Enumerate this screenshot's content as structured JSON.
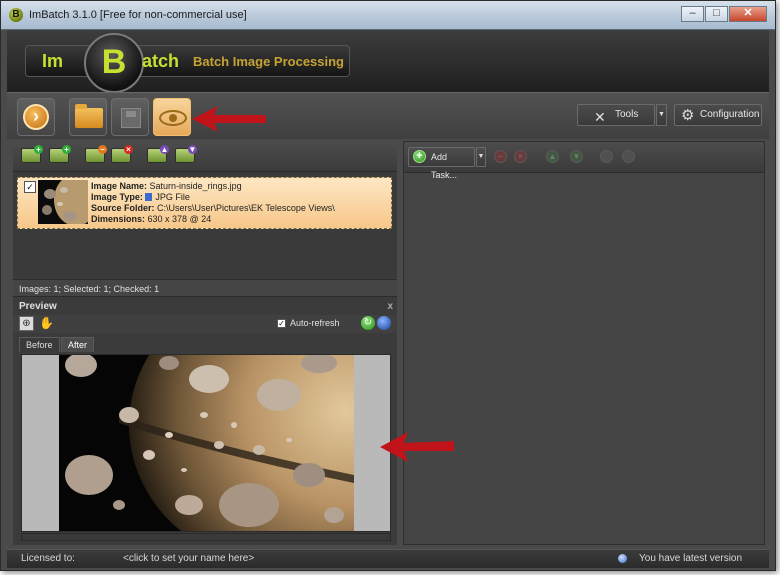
{
  "window": {
    "title": "ImBatch 3.1.0 [Free for non-commercial use]",
    "app_icon_letter": "B",
    "minimize_glyph": "–",
    "maximize_glyph": "□",
    "close_glyph": "✕"
  },
  "logo": {
    "prefix": "Im",
    "letter": "B",
    "suffix": "atch",
    "tagline": "Batch Image Processing",
    "accent_color": "#c8e030"
  },
  "toolbar": {
    "buttons": [
      {
        "name": "run",
        "icon": "play-arrow-icon",
        "glyph": "›",
        "active": false
      },
      {
        "name": "open",
        "icon": "folder-icon",
        "active": false
      },
      {
        "name": "save",
        "icon": "save-icon",
        "active": false
      },
      {
        "name": "preview",
        "icon": "eye-icon",
        "active": true
      }
    ],
    "tools_label": "Tools",
    "tools_glyph": "✕",
    "dropdown_glyph": "▼",
    "configuration_label": "Configuration",
    "configuration_glyph": "⚙"
  },
  "image_list_toolbar": {
    "buttons": [
      {
        "name": "add-images",
        "badge": "+",
        "badge_color": "green"
      },
      {
        "name": "add-folder",
        "badge": "+",
        "badge_color": "green"
      },
      {
        "name": "remove-image",
        "badge": "−",
        "badge_color": "orange"
      },
      {
        "name": "remove-all",
        "badge": "×",
        "badge_color": "red"
      },
      {
        "name": "move-up",
        "badge": "▲",
        "badge_color": "purple"
      },
      {
        "name": "move-down",
        "badge": "▼",
        "badge_color": "purple"
      }
    ]
  },
  "image_list": {
    "items": [
      {
        "checked": true,
        "check_glyph": "✓",
        "name_label": "Image Name:",
        "name_value": "Saturn-inside_rings.jpg",
        "type_label": "Image Type:",
        "type_value": "JPG File",
        "folder_label": "Source Folder:",
        "folder_value": "C:\\Users\\User\\Pictures\\EK Telescope Views\\",
        "dimensions_label": "Dimensions:",
        "dimensions_value": "630 x 378 @ 24"
      }
    ],
    "status": "Images: 1; Selected: 1; Checked: 1"
  },
  "preview": {
    "title": "Preview",
    "close_glyph": "x",
    "zoom_glyph": "⊕",
    "hand_glyph": "✋",
    "autorefresh_label": "Auto-refresh",
    "autorefresh_checked": true,
    "autorefresh_glyph": "✓",
    "refresh_glyph": "↻",
    "tabs": [
      {
        "label": "Before",
        "active": false
      },
      {
        "label": "After",
        "active": true
      }
    ]
  },
  "tasks": {
    "add_task_label": "Add Task...",
    "add_glyph": "+",
    "dropdown_glyph": "▼",
    "controls": [
      {
        "name": "remove-task",
        "glyph": "−",
        "color": "red"
      },
      {
        "name": "clear-tasks",
        "glyph": "×",
        "color": "red"
      },
      {
        "name": "move-task-up",
        "glyph": "▲",
        "color": "green"
      },
      {
        "name": "move-task-down",
        "glyph": "▼",
        "color": "green"
      },
      {
        "name": "task-option-1",
        "glyph": "",
        "color": "gray"
      },
      {
        "name": "task-option-2",
        "glyph": "",
        "color": "gray"
      }
    ]
  },
  "statusbar": {
    "licensed_label": "Licensed to:",
    "name_prompt": "<click to set your name here>",
    "version_status": "You have latest version"
  },
  "colors": {
    "annotation_arrow": "#c0141a",
    "selection_highlight": "#f7c789",
    "window_background": "#4a4a4a"
  }
}
